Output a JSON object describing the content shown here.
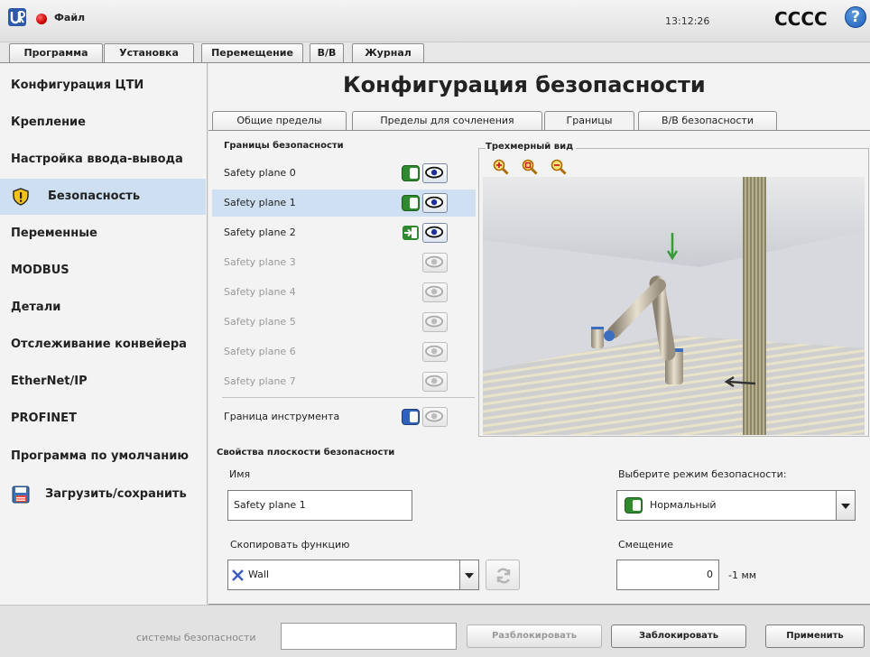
{
  "titlebar": {
    "file_menu": "Файл",
    "clock": "13:12:26",
    "robot_name": "CCCC",
    "help": "?"
  },
  "top_tabs": [
    {
      "label": "Программа"
    },
    {
      "label": "Установка"
    },
    {
      "label": "Перемещение"
    },
    {
      "label": "В/В"
    },
    {
      "label": "Журнал"
    }
  ],
  "sidebar": {
    "items": [
      {
        "label": "Конфигурация ЦТИ"
      },
      {
        "label": "Крепление"
      },
      {
        "label": "Настройка ввода-вывода"
      },
      {
        "label": "Безопасность"
      },
      {
        "label": "Переменные"
      },
      {
        "label": "MODBUS"
      },
      {
        "label": "Детали"
      },
      {
        "label": "Отслеживание конвейера"
      },
      {
        "label": "EtherNet/IP"
      },
      {
        "label": "PROFINET"
      },
      {
        "label": "Программа по умолчанию"
      },
      {
        "label": "Загрузить/сохранить"
      }
    ],
    "active_index": 3
  },
  "main": {
    "title": "Конфигурация безопасности",
    "sub_tabs": [
      {
        "label": "Общие пределы"
      },
      {
        "label": "Пределы для сочленения"
      },
      {
        "label": "Границы"
      },
      {
        "label": "В/В безопасности"
      }
    ],
    "boundaries": {
      "title": "Границы безопасности",
      "planes": [
        {
          "name": "Safety plane 0",
          "state": "normal"
        },
        {
          "name": "Safety plane 1",
          "state": "normal"
        },
        {
          "name": "Safety plane 2",
          "state": "trigger"
        },
        {
          "name": "Safety plane 3",
          "state": "disabled"
        },
        {
          "name": "Safety plane 4",
          "state": "disabled"
        },
        {
          "name": "Safety plane 5",
          "state": "disabled"
        },
        {
          "name": "Safety plane 6",
          "state": "disabled"
        },
        {
          "name": "Safety plane 7",
          "state": "disabled"
        }
      ],
      "tool_boundary": "Граница инструмента"
    },
    "view3d": {
      "title": "Трехмерный вид"
    },
    "properties": {
      "title": "Свойства плоскости безопасности",
      "name_label": "Имя",
      "name_value": "Safety plane 1",
      "copy_label": "Скопировать функцию",
      "copy_value": "Wall",
      "mode_label": "Выберите режим безопасности:",
      "mode_value": "Нормальный",
      "offset_label": "Смещение",
      "offset_value": "0",
      "offset_unit": "-1 мм"
    }
  },
  "bottom": {
    "password_label": "системы безопасности",
    "unlock": "Разблокировать",
    "lock": "Заблокировать",
    "apply": "Применить"
  },
  "colors": {
    "accent_blue": "#cfe0f2",
    "enable_green": "#2f8a2f"
  }
}
